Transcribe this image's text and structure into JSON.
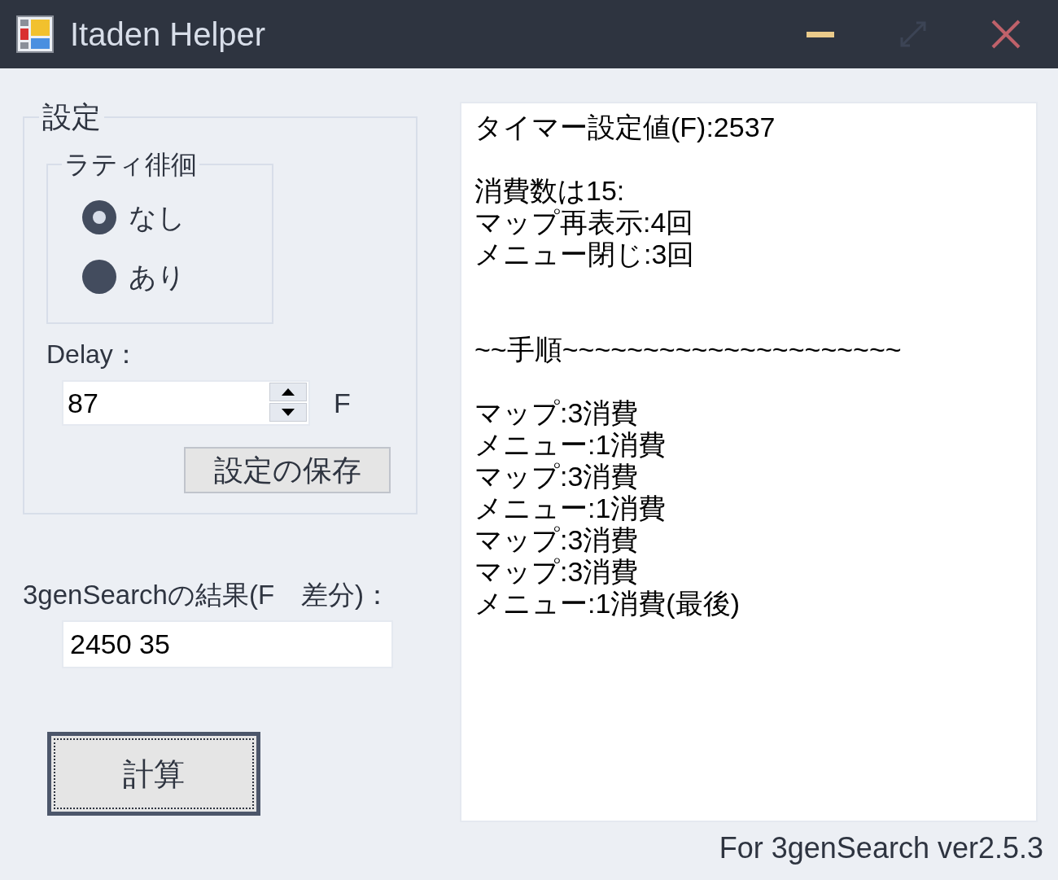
{
  "window": {
    "title": "Itaden Helper",
    "controls": [
      {
        "kind": "minimize",
        "disabled": false
      },
      {
        "kind": "maximize",
        "disabled": true
      },
      {
        "kind": "close",
        "disabled": false
      }
    ]
  },
  "settings": {
    "title": "設定",
    "wander_group": {
      "title": "ラティ徘徊",
      "options": [
        {
          "label": "なし",
          "selected": false
        },
        {
          "label": "あり",
          "selected": true
        }
      ]
    },
    "delay": {
      "label": "Delay：",
      "value": "87",
      "unit": "F"
    },
    "save_button": "設定の保存"
  },
  "result": {
    "label": "3genSearchの結果(F　差分)：",
    "value": "2450 35"
  },
  "calculate_button": {
    "label": "計算",
    "focused": true
  },
  "output": {
    "lines": [
      {
        "kind": "text",
        "text": "タイマー設定値(F):2537"
      },
      {
        "kind": "blank"
      },
      {
        "kind": "text",
        "text": "消費数は15:"
      },
      {
        "kind": "text",
        "text": "マップ再表示:4回"
      },
      {
        "kind": "text",
        "text": "メニュー閉じ:3回"
      },
      {
        "kind": "blank"
      },
      {
        "kind": "blank"
      },
      {
        "kind": "text",
        "text": "~~手順~~~~~~~~~~~~~~~~~~~~~"
      },
      {
        "kind": "blank"
      },
      {
        "kind": "text",
        "text": "マップ:3消費"
      },
      {
        "kind": "text",
        "text": "メニュー:1消費"
      },
      {
        "kind": "text",
        "text": "マップ:3消費"
      },
      {
        "kind": "text",
        "text": "メニュー:1消費"
      },
      {
        "kind": "text",
        "text": "マップ:3消費"
      },
      {
        "kind": "text",
        "text": "マップ:3消費"
      },
      {
        "kind": "text",
        "text": "メニュー:1消費(最後)"
      }
    ]
  },
  "footer": "For 3genSearch ver2.5.3"
}
